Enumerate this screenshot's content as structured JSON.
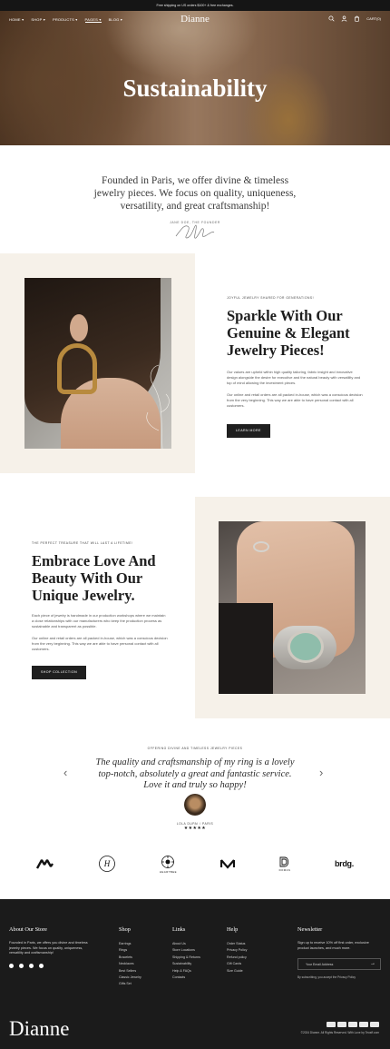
{
  "announcement": "Free shipping on US orders $100+ & free exchanges.",
  "nav": {
    "links": [
      "HOME",
      "SHOP",
      "PRODUCTS",
      "PAGES",
      "BLOG"
    ],
    "logo": "Dianne",
    "cart_label": "CART(0)"
  },
  "hero": {
    "title": "Sustainability"
  },
  "intro": {
    "quote": "Founded in Paris, we offer divine & timeless jewelry pieces. We focus on quality, uniqueness, versatility, and great craftsmanship!",
    "author": "JANE DOE, THE FOUNDER"
  },
  "section1": {
    "eyebrow": "JOYFUL JEWELRY SHARED FOR GENERATIONS!",
    "title": "Sparkle With Our Genuine & Elegant Jewelry Pieces!",
    "para1": "Our values are upheld within high quality tailoring, fabric insight and innovative design alongside the desire for executive and the natural beauty with versatility and top of mind allowing the investment pieces.",
    "para2": "Our online and retail orders are all packed in-house, which was a conscious decision from the very beginning. This way we are able to have personal contact with all customers.",
    "button": "LEARN MORE"
  },
  "section2": {
    "eyebrow": "THE PERFECT TREASURE THAT WILL LAST A LIFETIME!",
    "title": "Embrace Love And Beauty With Our Unique Jewelry.",
    "para1": "Each piece of jewelry is handmade in our production workshops where we maintain a close relationships with our manufacturers who keep the production process as sustainable and transparent as possible.",
    "para2": "Our online and retail orders are all packed in-house, which was a conscious decision from the very beginning. This way we are able to have personal contact with all customers.",
    "button": "SHOP COLLECTION"
  },
  "testimonial": {
    "eyebrow": "OFFERING DIVINE AND TIMELESS JEWELRY PIECES",
    "quote": "The quality and craftsmanship of my ring is a lovely top-notch, absolutely a great and fantastic service.  Love it and truly so happy!",
    "name": "LOLA DUPAI / PARIS",
    "stars": "★★★★★"
  },
  "brands": {
    "logo2": "H",
    "logo3_label": "HEARTBEE",
    "logo5_label": "DOMAS",
    "logo6": "brdg."
  },
  "footer": {
    "about": {
      "title": "About Our Store",
      "text": "Founded in Paris, we offers you divine and timeless jewelry pieces. We focus on quality, uniqueness, versatility and craftsmanship!"
    },
    "shop": {
      "title": "Shop",
      "items": [
        "Earrings",
        "Rings",
        "Bracelets",
        "Necklaces",
        "Best Sellers",
        "Classic Jewelry",
        "Gifts Set"
      ]
    },
    "links": {
      "title": "Links",
      "items": [
        "About Us",
        "Store Locations",
        "Shipping & Returns",
        "Sustainability",
        "Help & FAQs",
        "Contacts"
      ]
    },
    "help": {
      "title": "Help",
      "items": [
        "Order Status",
        "Privacy Policy",
        "Refund policy",
        "Gift Cards",
        "Size Guide"
      ]
    },
    "newsletter": {
      "title": "Newsletter",
      "text": "Sign up to receive 10% off first order, exclusive product launches, and much more.",
      "placeholder": "Your Email Address",
      "consent": "By subscribing, you accept the Privacy Policy"
    },
    "logo": "Dianne",
    "copyright": "©2024 Dianne. All Rights Reserved. With Love by Teosff.com"
  }
}
